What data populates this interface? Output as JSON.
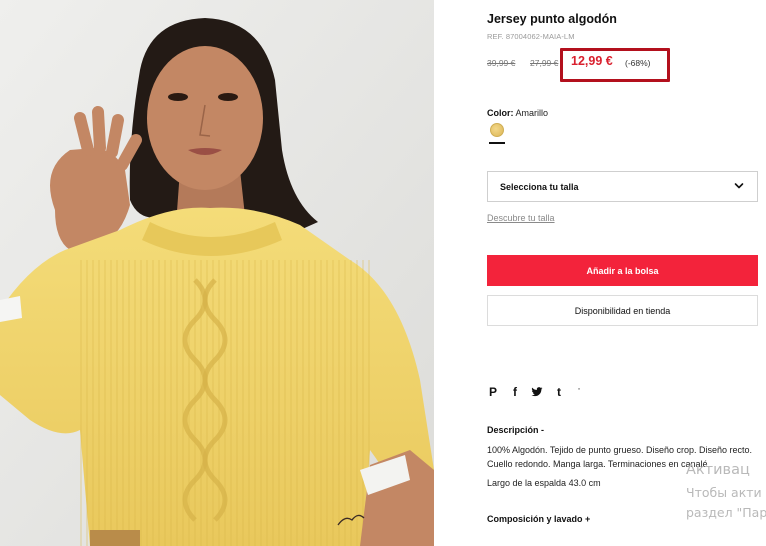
{
  "product": {
    "title": "Jersey punto algodón",
    "ref": "REF. 87004062-MAIA-LM",
    "price": {
      "original": "39,99 €",
      "previous": "27,99 €",
      "sale": "12,99 €",
      "discount": "(-68%)"
    },
    "color": {
      "label": "Color:",
      "value": "Amarillo",
      "swatch_hex": "#e8c86a"
    }
  },
  "size": {
    "select_label": "Selecciona tu talla",
    "guide_link": "Descubre tu talla"
  },
  "buttons": {
    "add_to_bag": "Añadir a la bolsa",
    "store_availability": "Disponibilidad en tienda"
  },
  "share": {
    "icons": [
      "pinterest-icon",
      "facebook-icon",
      "twitter-icon",
      "tumblr-icon",
      "more-icon"
    ],
    "glyphs": [
      "P",
      "f",
      "",
      "t",
      "'"
    ]
  },
  "description": {
    "heading": "Descripción  -",
    "text": "100% Algodón. Tejido de punto grueso. Diseño crop. Diseño recto. Cuello redondo. Manga larga. Terminaciones en canalé.",
    "length": "Largo de la espalda 43.0 cm",
    "composition_heading": "Composición y lavado  +"
  },
  "watermark": {
    "line1": "Активац",
    "line2": "Чтобы акти",
    "line3": "раздел \"Пар"
  },
  "colors": {
    "accent_red": "#f3233b",
    "sale_red": "#d9202e",
    "highlight_border": "#b3101d",
    "sweater_yellow": "#f2d770"
  }
}
